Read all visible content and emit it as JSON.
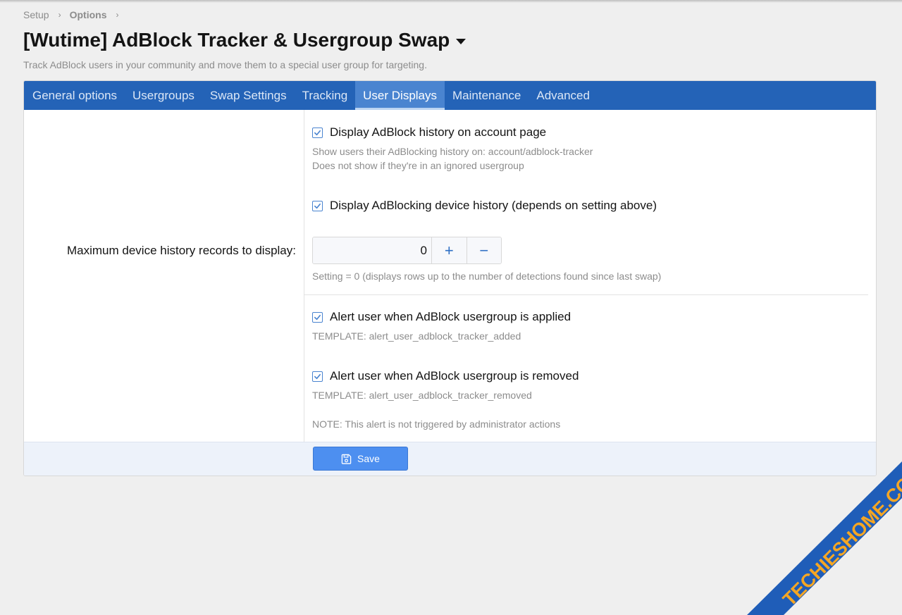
{
  "breadcrumb": {
    "items": [
      "Setup",
      "Options"
    ]
  },
  "header": {
    "title": "[Wutime] AdBlock Tracker & Usergroup Swap",
    "description": "Track AdBlock users in your community and move them to a special user group for targeting."
  },
  "tabs": [
    {
      "label": "General options",
      "active": false
    },
    {
      "label": "Usergroups",
      "active": false
    },
    {
      "label": "Swap Settings",
      "active": false
    },
    {
      "label": "Tracking",
      "active": false
    },
    {
      "label": "User Displays",
      "active": true
    },
    {
      "label": "Maintenance",
      "active": false
    },
    {
      "label": "Advanced",
      "active": false
    }
  ],
  "options": {
    "display_history": {
      "label": "Display AdBlock history on account page",
      "checked": true,
      "hint_line1": "Show users their AdBlocking history on: account/adblock-tracker",
      "hint_line2": "Does not show if they're in an ignored usergroup"
    },
    "display_device_history": {
      "label": "Display AdBlocking device history (depends on setting above)",
      "checked": true
    },
    "max_records": {
      "row_label": "Maximum device history records to display:",
      "value": "0",
      "plus": "+",
      "minus": "−",
      "hint": "Setting = 0 (displays rows up to the number of detections found since last swap)"
    },
    "alert_applied": {
      "label": "Alert user when AdBlock usergroup is applied",
      "checked": true,
      "hint": "TEMPLATE: alert_user_adblock_tracker_added"
    },
    "alert_removed": {
      "label": "Alert user when AdBlock usergroup is removed",
      "checked": true,
      "hint": "TEMPLATE: alert_user_adblock_tracker_removed",
      "note": "NOTE: This alert is not triggered by administrator actions"
    }
  },
  "footer": {
    "save_label": "Save"
  },
  "watermark": {
    "text": "TECHIESHOME.COM"
  },
  "colors": {
    "tab_bar": "#2463b7",
    "tab_active": "#4a84d0",
    "accent": "#4d8ff0",
    "watermark_band": "#1f5db8",
    "watermark_text": "#f5a623"
  }
}
